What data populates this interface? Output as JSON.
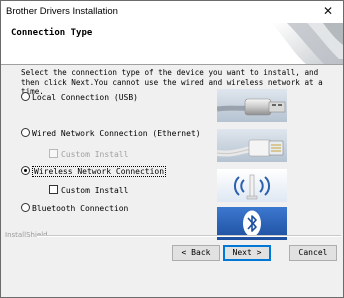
{
  "window": {
    "title": "Brother Drivers Installation",
    "close_glyph": "✕"
  },
  "header": {
    "heading": "Connection Type"
  },
  "description": "Select the connection type of the device you want to install, and then click Next.You cannot use the wired and wireless network at a time.",
  "options": {
    "usb": {
      "label": "Local Connection (USB)",
      "selected": false
    },
    "ethernet": {
      "label": "Wired Network Connection (Ethernet)",
      "selected": false
    },
    "ethernet_custom": {
      "label": "Custom Install",
      "checked": false,
      "enabled": false
    },
    "wireless": {
      "label": "Wireless Network Connection",
      "selected": true
    },
    "wireless_custom": {
      "label": "Custom Install",
      "checked": false,
      "enabled": true
    },
    "bluetooth": {
      "label": "Bluetooth Connection",
      "selected": false
    }
  },
  "icons": {
    "usb": "usb-cable-icon",
    "ethernet": "ethernet-cable-icon",
    "wireless": "wireless-icon",
    "bluetooth": "bluetooth-icon"
  },
  "footer": {
    "branding": "InstallShield",
    "back_label": "< Back",
    "next_label": "Next >",
    "cancel_label": "Cancel"
  },
  "colors": {
    "accent": "#0078d7",
    "tile_blue": "#2a5fb0",
    "header_bg": "#ffffff",
    "dialog_bg": "#f0f0f0"
  }
}
